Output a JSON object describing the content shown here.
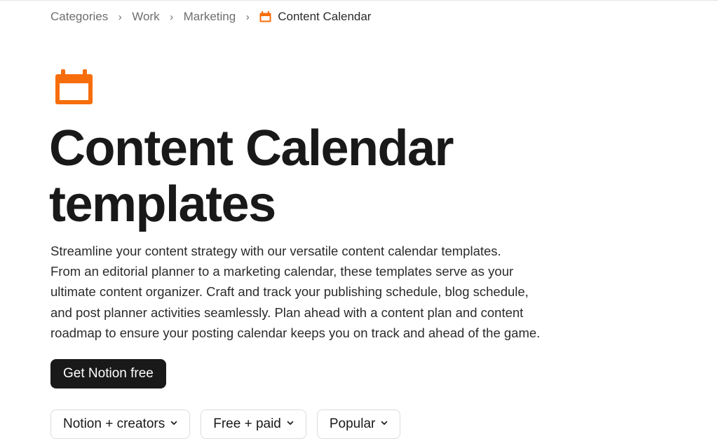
{
  "breadcrumb": {
    "items": [
      "Categories",
      "Work",
      "Marketing"
    ],
    "current": "Content Calendar",
    "separator": "›"
  },
  "hero": {
    "icon": "calendar-icon",
    "icon_color": "#f76d0c",
    "title_lines": [
      "Content Calendar",
      "templates"
    ],
    "description_lines": [
      "Streamline your content strategy with our versatile content calendar templates.",
      "From an editorial planner to a marketing calendar, these templates serve as your",
      "ultimate content organizer. Craft and track your publishing schedule, blog schedule,",
      "and post planner activities seamlessly. Plan ahead with a content plan and content",
      "roadmap to ensure your posting calendar keeps you on track and ahead of the game."
    ]
  },
  "cta": {
    "label": "Get Notion free",
    "background": "#191919"
  },
  "filters": [
    {
      "label": "Notion + creators",
      "icon": "chevron-down-icon"
    },
    {
      "label": "Free + paid",
      "icon": "chevron-down-icon"
    },
    {
      "label": "Popular",
      "icon": "chevron-down-icon"
    }
  ]
}
